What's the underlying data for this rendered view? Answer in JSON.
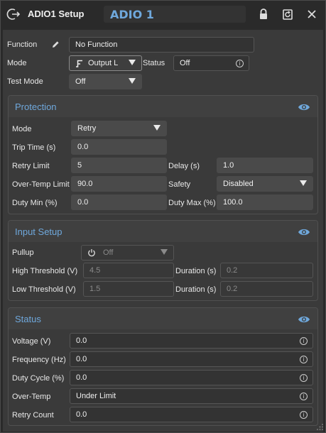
{
  "titlebar": {
    "title": "ADIO1 Setup",
    "name_value": "ADIO 1",
    "icons": [
      "exit-icon",
      "lock-icon",
      "reset-icon",
      "close-icon"
    ]
  },
  "general": {
    "function_label": "Function",
    "function_value": "No Function",
    "mode_label": "Mode",
    "mode_value": "Output L",
    "status_label": "Status",
    "status_value": "Off",
    "test_mode_label": "Test Mode",
    "test_mode_value": "Off"
  },
  "protection": {
    "title": "Protection",
    "mode_label": "Mode",
    "mode_value": "Retry",
    "trip_time_label": "Trip Time (s)",
    "trip_time_value": "0.0",
    "retry_limit_label": "Retry Limit",
    "retry_limit_value": "5",
    "delay_label": "Delay (s)",
    "delay_value": "1.0",
    "over_temp_label": "Over-Temp Limit",
    "over_temp_value": "90.0",
    "safety_label": "Safety",
    "safety_value": "Disabled",
    "duty_min_label": "Duty Min (%)",
    "duty_min_value": "0.0",
    "duty_max_label": "Duty Max (%)",
    "duty_max_value": "100.0"
  },
  "input_setup": {
    "title": "Input Setup",
    "pullup_label": "Pullup",
    "pullup_value": "Off",
    "high_threshold_label": "High Threshold (V)",
    "high_threshold_value": "4.5",
    "high_duration_label": "Duration (s)",
    "high_duration_value": "0.2",
    "low_threshold_label": "Low Threshold (V)",
    "low_threshold_value": "1.5",
    "low_duration_label": "Duration (s)",
    "low_duration_value": "0.2"
  },
  "status": {
    "title": "Status",
    "rows": [
      {
        "label": "Voltage (V)",
        "value": "0.0"
      },
      {
        "label": "Frequency (Hz)",
        "value": "0.0"
      },
      {
        "label": "Duty Cycle (%)",
        "value": "0.0"
      },
      {
        "label": "Over-Temp",
        "value": "Under Limit"
      },
      {
        "label": "Retry Count",
        "value": "0.0"
      }
    ]
  },
  "colors": {
    "accent": "#6fa8dc",
    "background": "#3a3a3a"
  }
}
